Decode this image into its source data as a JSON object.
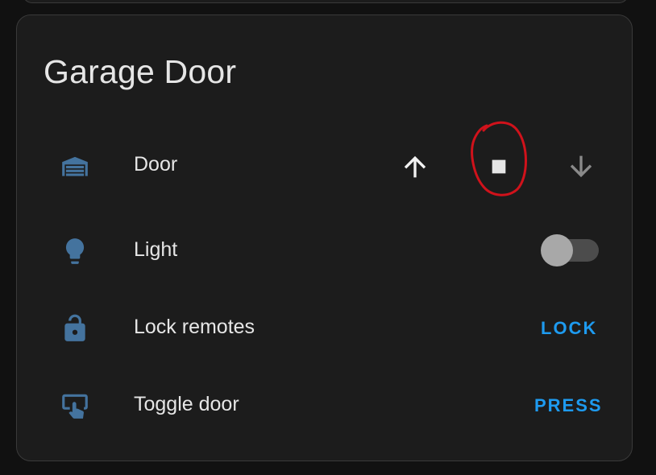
{
  "card": {
    "title": "Garage Door"
  },
  "colors": {
    "icon": "#44739e",
    "action": "#1e9bf0",
    "annotation": "#d0121b"
  },
  "rows": [
    {
      "label": "Door",
      "icon": "garage-icon",
      "controls": {
        "open_icon": "arrow-up-icon",
        "stop_icon": "stop-icon",
        "close_icon": "arrow-down-icon"
      }
    },
    {
      "label": "Light",
      "icon": "lightbulb-icon",
      "toggle_state": "off"
    },
    {
      "label": "Lock remotes",
      "icon": "lock-open-icon",
      "action_label": "LOCK"
    },
    {
      "label": "Toggle door",
      "icon": "gesture-tap-button-icon",
      "action_label": "PRESS"
    }
  ]
}
